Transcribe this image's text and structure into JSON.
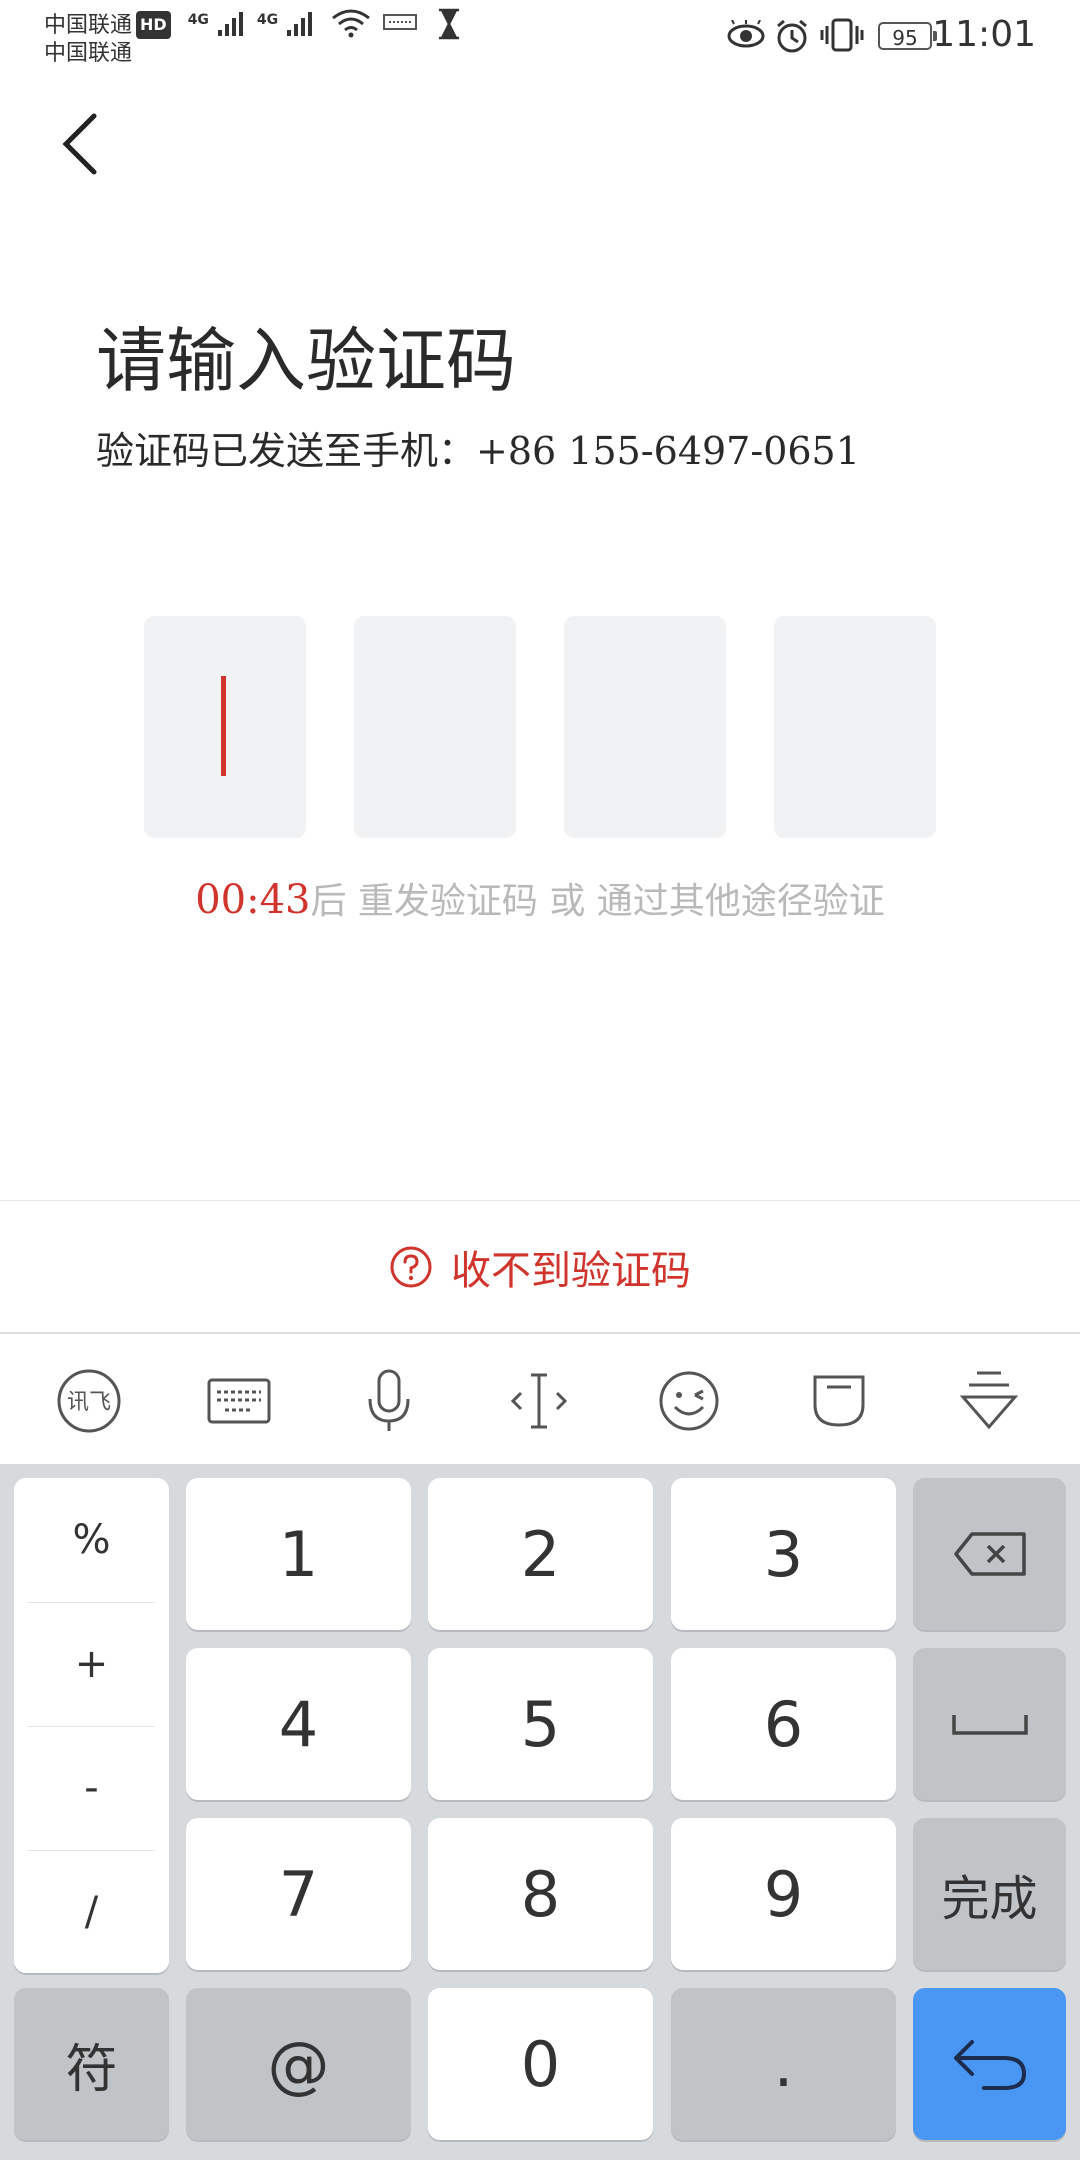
{
  "status_bar": {
    "carrier1": "中国联通",
    "hd": "HD",
    "carrier2": "中国联通",
    "net1": "4G",
    "net2": "4G",
    "battery": "95",
    "time": "11:01"
  },
  "page": {
    "title": "请输入验证码",
    "subtitle": "验证码已发送至手机：+86 155-6497-0651",
    "countdown": "00:43",
    "resend_text": "后 重发验证码 或 通过其他途径验证",
    "no_code_label": "收不到验证码",
    "accent_color": "#d0342c"
  },
  "code_inputs": {
    "count": 4,
    "active_index": 0
  },
  "keyboard": {
    "toolbar": [
      "ifly-logo-icon",
      "keyboard-icon",
      "microphone-icon",
      "cursor-move-icon",
      "emoji-icon",
      "clipboard-icon",
      "collapse-keyboard-icon"
    ],
    "symbols": [
      "%",
      "+",
      "-",
      "/"
    ],
    "digits": [
      "1",
      "2",
      "3",
      "4",
      "5",
      "6",
      "7",
      "8",
      "9",
      "0"
    ],
    "done_label": "完成",
    "symbol_key_label": "符",
    "at_label": "@",
    "dot_label": ".",
    "enter_color": "#4a97f3"
  }
}
